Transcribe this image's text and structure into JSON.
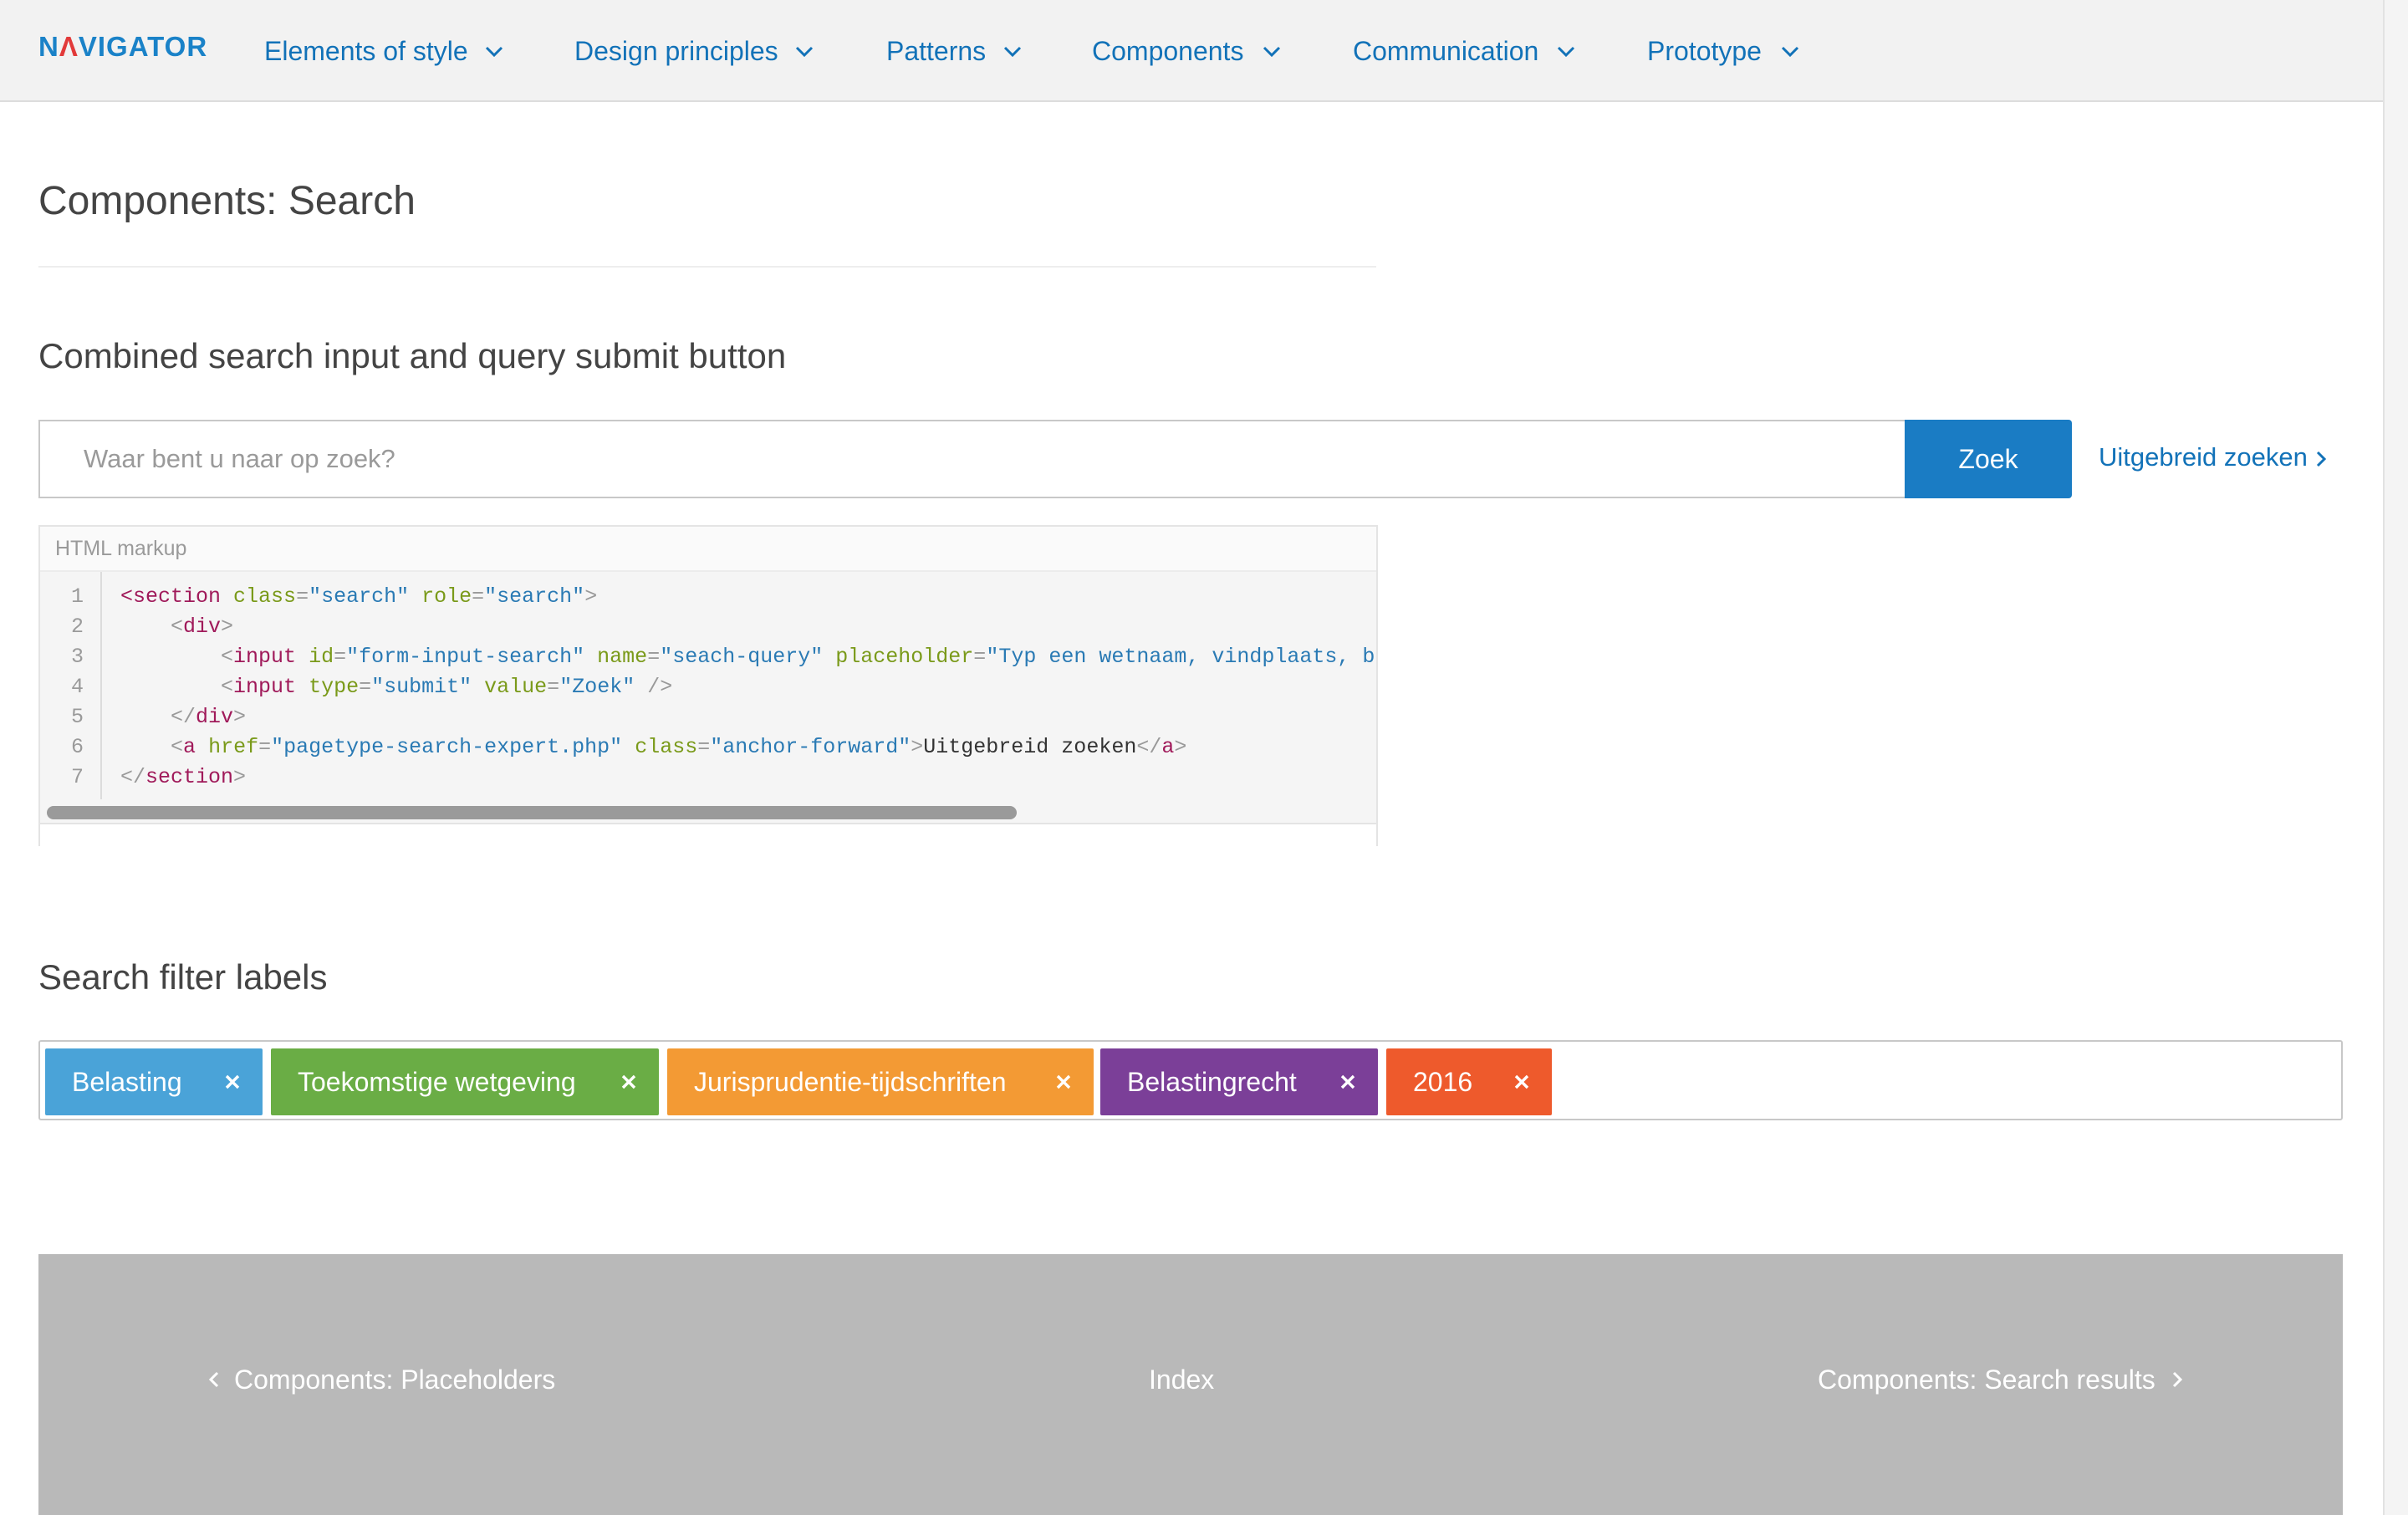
{
  "header": {
    "logo": {
      "before": "N",
      "accent": "Λ",
      "after": "VIGATOR"
    },
    "nav": [
      {
        "label": "Elements of style"
      },
      {
        "label": "Design principles"
      },
      {
        "label": "Patterns"
      },
      {
        "label": "Components"
      },
      {
        "label": "Communication"
      },
      {
        "label": "Prototype"
      }
    ]
  },
  "page": {
    "title": "Components: Search"
  },
  "search_section": {
    "heading": "Combined search input and query submit button",
    "input": {
      "value": "",
      "placeholder": "Waar bent u naar op zoek?"
    },
    "button_label": "Zoek",
    "advanced_link": "Uitgebreid zoeken"
  },
  "code_box": {
    "header": "HTML markup",
    "line_numbers": [
      "1",
      "2",
      "3",
      "4",
      "5",
      "6",
      "7"
    ],
    "lines": [
      [
        {
          "t": "tg",
          "v": "<section"
        },
        {
          "t": "tx",
          "v": " "
        },
        {
          "t": "at",
          "v": "class"
        },
        {
          "t": "pn",
          "v": "="
        },
        {
          "t": "vl",
          "v": "\"search\""
        },
        {
          "t": "tx",
          "v": " "
        },
        {
          "t": "at",
          "v": "role"
        },
        {
          "t": "pn",
          "v": "="
        },
        {
          "t": "vl",
          "v": "\"search\""
        },
        {
          "t": "pn",
          "v": ">"
        }
      ],
      [
        {
          "t": "tx",
          "v": "    "
        },
        {
          "t": "pn",
          "v": "<"
        },
        {
          "t": "tg",
          "v": "div"
        },
        {
          "t": "pn",
          "v": ">"
        }
      ],
      [
        {
          "t": "tx",
          "v": "        "
        },
        {
          "t": "pn",
          "v": "<"
        },
        {
          "t": "tg",
          "v": "input"
        },
        {
          "t": "tx",
          "v": " "
        },
        {
          "t": "at",
          "v": "id"
        },
        {
          "t": "pn",
          "v": "="
        },
        {
          "t": "vl",
          "v": "\"form-input-search\""
        },
        {
          "t": "tx",
          "v": " "
        },
        {
          "t": "at",
          "v": "name"
        },
        {
          "t": "pn",
          "v": "="
        },
        {
          "t": "vl",
          "v": "\"seach-query\""
        },
        {
          "t": "tx",
          "v": " "
        },
        {
          "t": "at",
          "v": "placeholder"
        },
        {
          "t": "pn",
          "v": "="
        },
        {
          "t": "vl",
          "v": "\"Typ een wetnaam, vindplaats, bron e"
        }
      ],
      [
        {
          "t": "tx",
          "v": "        "
        },
        {
          "t": "pn",
          "v": "<"
        },
        {
          "t": "tg",
          "v": "input"
        },
        {
          "t": "tx",
          "v": " "
        },
        {
          "t": "at",
          "v": "type"
        },
        {
          "t": "pn",
          "v": "="
        },
        {
          "t": "vl",
          "v": "\"submit\""
        },
        {
          "t": "tx",
          "v": " "
        },
        {
          "t": "at",
          "v": "value"
        },
        {
          "t": "pn",
          "v": "="
        },
        {
          "t": "vl",
          "v": "\"Zoek\""
        },
        {
          "t": "tx",
          "v": " "
        },
        {
          "t": "pn",
          "v": "/>"
        }
      ],
      [
        {
          "t": "tx",
          "v": "    "
        },
        {
          "t": "pn",
          "v": "</"
        },
        {
          "t": "tg",
          "v": "div"
        },
        {
          "t": "pn",
          "v": ">"
        }
      ],
      [
        {
          "t": "tx",
          "v": "    "
        },
        {
          "t": "pn",
          "v": "<"
        },
        {
          "t": "tg",
          "v": "a"
        },
        {
          "t": "tx",
          "v": " "
        },
        {
          "t": "at",
          "v": "href"
        },
        {
          "t": "pn",
          "v": "="
        },
        {
          "t": "vl",
          "v": "\"pagetype-search-expert.php\""
        },
        {
          "t": "tx",
          "v": " "
        },
        {
          "t": "at",
          "v": "class"
        },
        {
          "t": "pn",
          "v": "="
        },
        {
          "t": "vl",
          "v": "\"anchor-forward\""
        },
        {
          "t": "pn",
          "v": ">"
        },
        {
          "t": "tx",
          "v": "Uitgebreid zoeken"
        },
        {
          "t": "pn",
          "v": "</"
        },
        {
          "t": "tg",
          "v": "a"
        },
        {
          "t": "pn",
          "v": ">"
        }
      ],
      [
        {
          "t": "pn",
          "v": "</"
        },
        {
          "t": "tg",
          "v": "section"
        },
        {
          "t": "pn",
          "v": ">"
        }
      ]
    ]
  },
  "filter_section": {
    "heading": "Search filter labels",
    "labels": [
      {
        "text": "Belasting",
        "color": "#4aa3d8"
      },
      {
        "text": "Toekomstige wetgeving",
        "color": "#6aad45"
      },
      {
        "text": "Jurisprudentie-tijdschriften",
        "color": "#f39a34"
      },
      {
        "text": "Belastingrecht",
        "color": "#7b3f98"
      },
      {
        "text": "2016",
        "color": "#ee5a2c"
      }
    ]
  },
  "footer": {
    "prev": "Components: Placeholders",
    "index": "Index",
    "next": "Components: Search results"
  },
  "colors": {
    "link_blue": "#1272b8",
    "button_blue": "#1a7cc4",
    "footer_gray": "#b9b9b9",
    "logo_accent": "#e23a3a"
  }
}
